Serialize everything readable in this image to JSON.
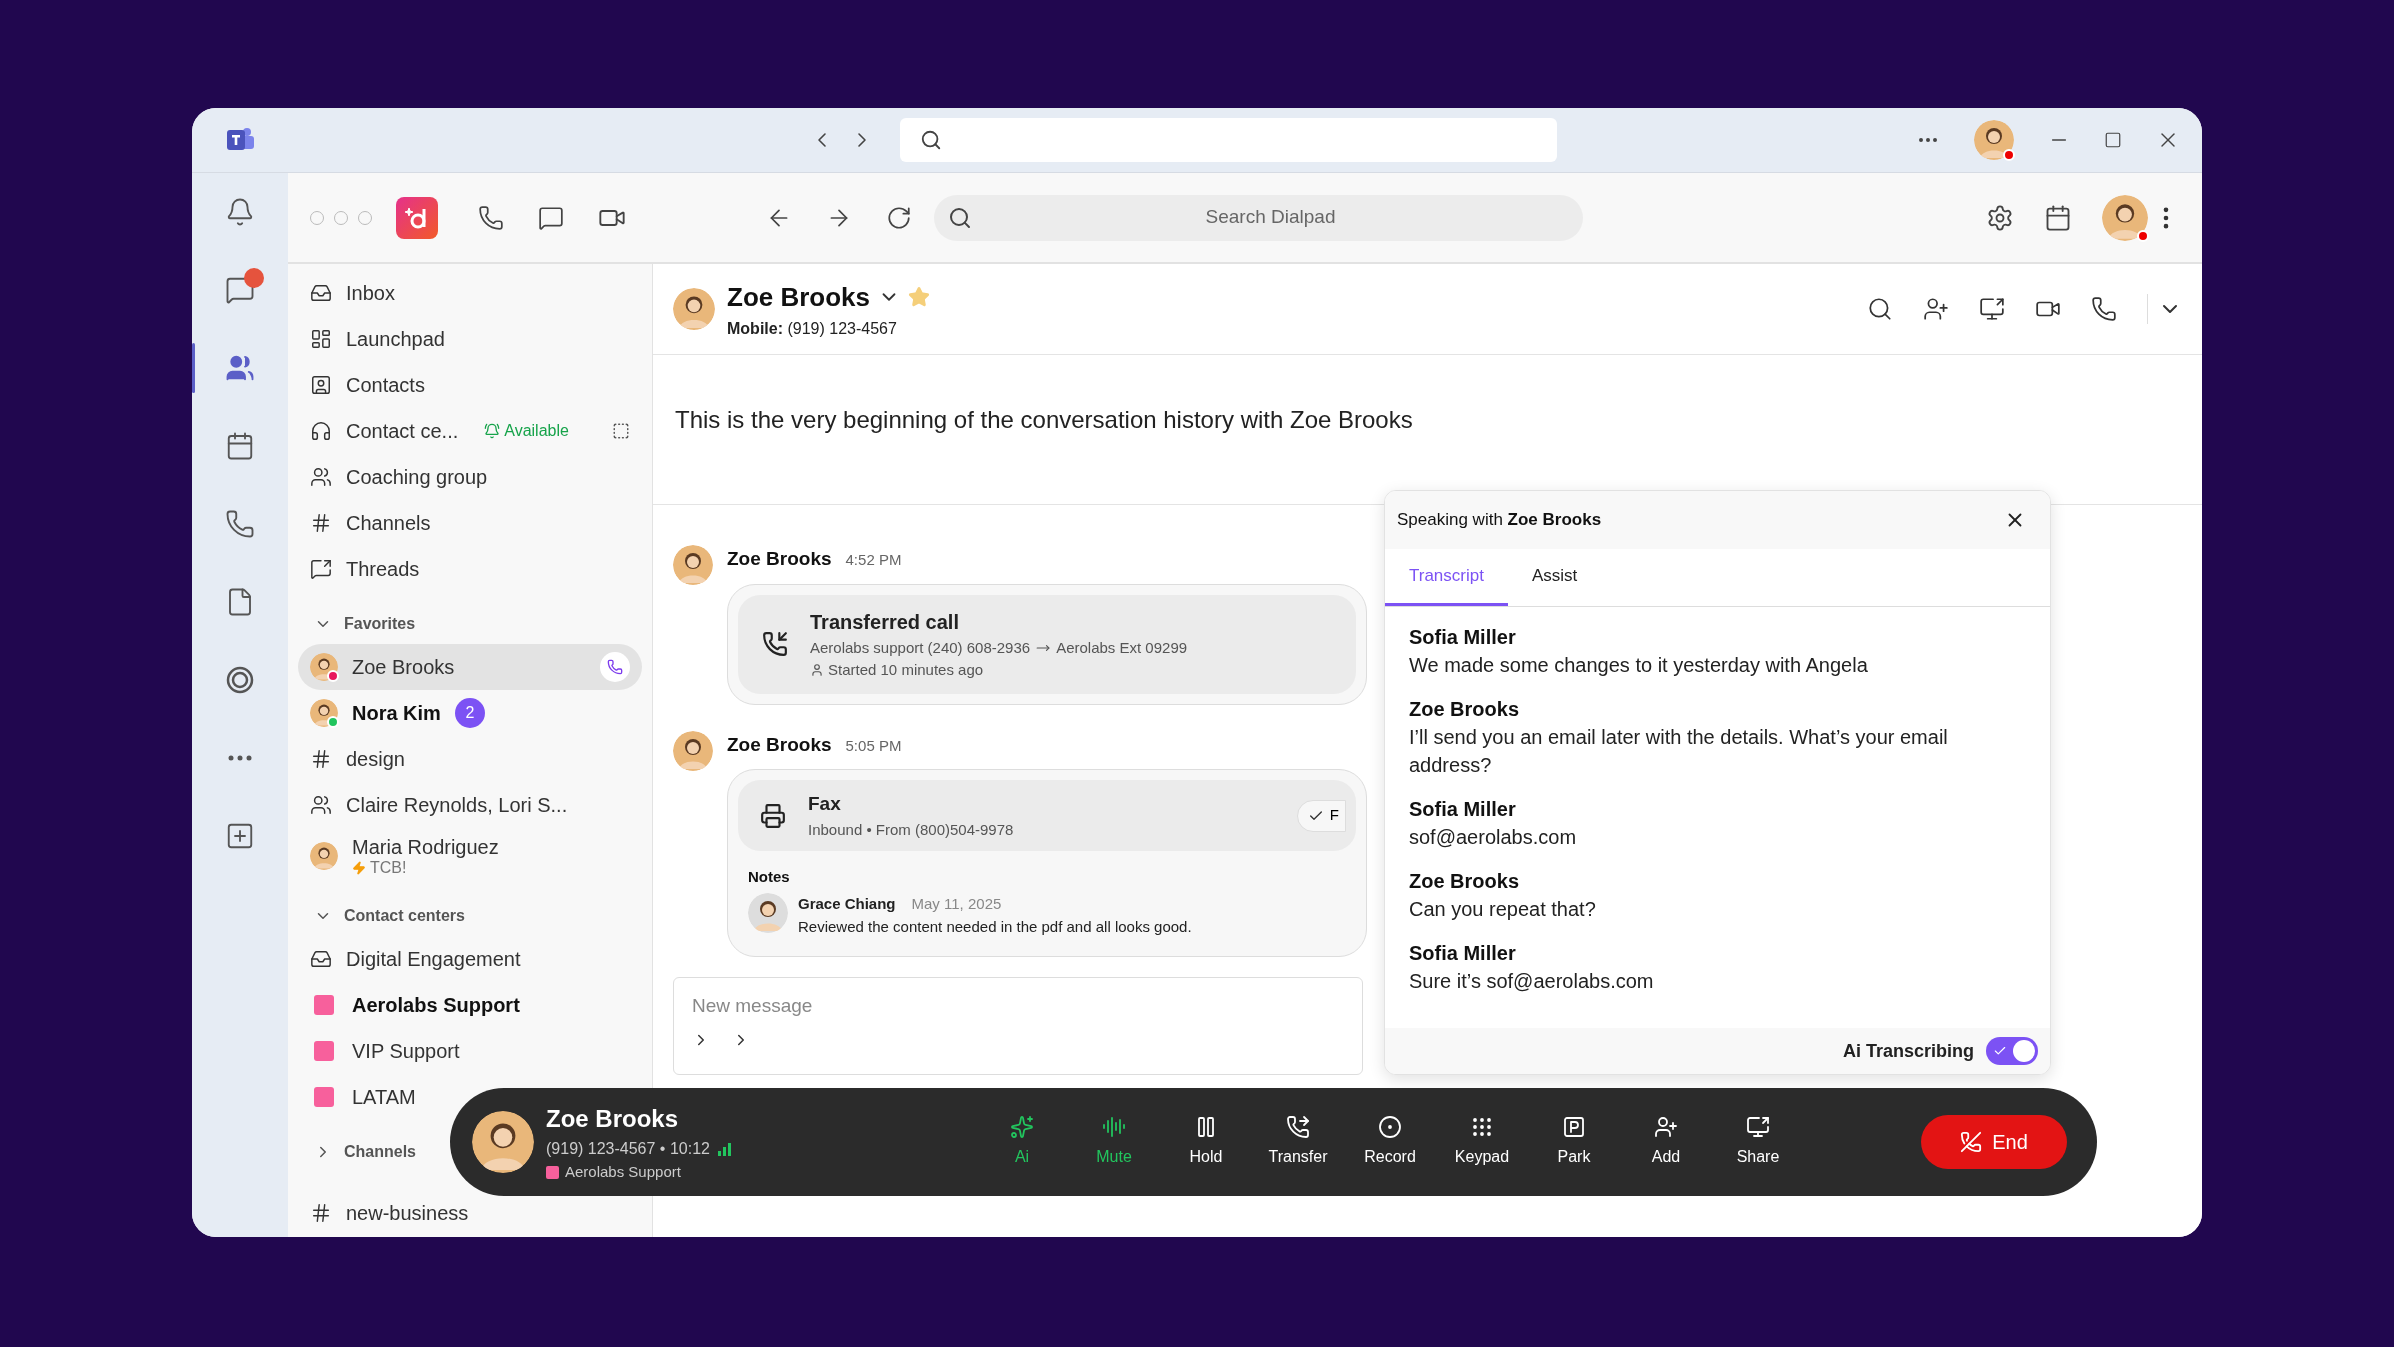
{
  "rail": [
    {
      "kind": "bell",
      "selected": false,
      "badge": false
    },
    {
      "kind": "chat",
      "selected": false,
      "badge": true
    },
    {
      "kind": "teams",
      "selected": true,
      "badge": false
    },
    {
      "kind": "calendar",
      "selected": false,
      "badge": false
    },
    {
      "kind": "phone",
      "selected": false,
      "badge": false
    },
    {
      "kind": "file",
      "selected": false,
      "badge": false
    },
    {
      "kind": "loop",
      "selected": false,
      "badge": false
    },
    {
      "kind": "more",
      "selected": false,
      "badge": false
    },
    {
      "kind": "add",
      "selected": false,
      "badge": false
    }
  ],
  "toolbar": {
    "search": {
      "placeholder": "Search Dialpad"
    }
  },
  "sidebar": {
    "nav": [
      {
        "kind": "inbox",
        "label": "Inbox"
      },
      {
        "kind": "launchpad",
        "label": "Launchpad"
      },
      {
        "kind": "contacts",
        "label": "Contacts"
      },
      {
        "kind": "headset",
        "label": "Contact ce...",
        "status": "Available"
      },
      {
        "kind": "group",
        "label": "Coaching group"
      },
      {
        "kind": "hash",
        "label": "Channels"
      },
      {
        "kind": "threads",
        "label": "Threads"
      }
    ],
    "sections": [
      {
        "title": "Favorites",
        "expanded": true,
        "items": [
          {
            "kind": "person",
            "label": "Zoe Brooks",
            "selected": true,
            "unread": false,
            "color": "#e8175d",
            "call": true
          },
          {
            "kind": "person",
            "label": "Nora Kim",
            "selected": false,
            "unread": true,
            "color": "#22c55e",
            "count": "2"
          },
          {
            "kind": "hash",
            "label": "design",
            "selected": false,
            "unread": false
          },
          {
            "kind": "group",
            "label": "Claire Reynolds, Lori S...",
            "selected": false,
            "unread": false
          },
          {
            "kind": "person",
            "label": "Maria Rodriguez",
            "selected": false,
            "unread": false,
            "subtitle": "TCB!"
          }
        ]
      },
      {
        "title": "Contact centers",
        "expanded": true,
        "items": [
          {
            "kind": "inbox",
            "label": "Digital Engagement",
            "selected": false,
            "unread": false
          },
          {
            "kind": "queue",
            "label": "Aerolabs Support",
            "selected": false,
            "unread": true,
            "color": "#f7609c"
          },
          {
            "kind": "queue",
            "label": "VIP Support",
            "selected": false,
            "unread": false,
            "color": "#f7609c"
          },
          {
            "kind": "queue",
            "label": "LATAM",
            "selected": false,
            "unread": false,
            "color": "#f7609c"
          }
        ]
      },
      {
        "title": "Channels",
        "expanded": false,
        "items": [
          {
            "kind": "hash",
            "label": "new-business",
            "selected": false,
            "unread": false
          }
        ]
      }
    ]
  },
  "conversation": {
    "name": "Zoe Brooks",
    "starred": true,
    "phone_label": "Mobile:",
    "phone": "(919) 123-4567",
    "intro": "This is the very beginning of the conversation history with Zoe Brooks",
    "messages": [
      {
        "sender": "Zoe Brooks",
        "time": "4:52 PM",
        "card": {
          "kind": "transfer",
          "title": "Transferred call",
          "from": "Aerolabs support (240) 608-2936",
          "to": "Aerolabs Ext 09299",
          "meta": "Started 10 minutes ago"
        }
      },
      {
        "sender": "Zoe Brooks",
        "time": "5:05 PM",
        "card": {
          "kind": "fax",
          "title": "Fax",
          "detail": "Inbound • From (800)504-9978",
          "chip": "F",
          "notes_title": "Notes",
          "note": {
            "author": "Grace Chiang",
            "date": "May 11, 2025",
            "text": "Reviewed the content needed in the pdf and all looks good."
          }
        }
      }
    ],
    "composer": {
      "placeholder": "New message"
    }
  },
  "panel": {
    "title": "Speaking with **Zoe Brooks**",
    "tabs": [
      {
        "label": "Transcript",
        "selected": true
      },
      {
        "label": "Assist",
        "selected": false
      }
    ],
    "transcript": [
      {
        "speaker": "Sofia Miller",
        "text": "We made some changes to it yesterday with Angela"
      },
      {
        "speaker": "Zoe Brooks",
        "text": "I’ll send you an email later with the details. What’s your email address?"
      },
      {
        "speaker": "Sofia Miller",
        "text": "sof@aerolabs.com"
      },
      {
        "speaker": "Zoe Brooks",
        "text": "Can you repeat that?"
      },
      {
        "speaker": "Sofia Miller",
        "text": "Sure it’s sof@aerolabs.com"
      }
    ],
    "toggle": {
      "label": "Ai Transcribing",
      "on": true
    }
  },
  "call_bar": {
    "name": "Zoe Brooks",
    "details": "(919) 123-4567 • 10:12",
    "queue": {
      "name": "Aerolabs Support",
      "color": "#f7609c"
    },
    "controls": [
      {
        "kind": "ai",
        "label": "Ai",
        "active": true
      },
      {
        "kind": "mute",
        "label": "Mute",
        "active": true
      },
      {
        "kind": "hold",
        "label": "Hold",
        "active": false
      },
      {
        "kind": "transfer",
        "label": "Transfer",
        "active": false
      },
      {
        "kind": "record",
        "label": "Record",
        "active": false
      },
      {
        "kind": "keypad",
        "label": "Keypad",
        "active": false
      },
      {
        "kind": "park",
        "label": "Park",
        "active": false
      },
      {
        "kind": "add",
        "label": "Add",
        "active": false
      },
      {
        "kind": "share",
        "label": "Share",
        "active": false
      }
    ],
    "end": "End"
  }
}
